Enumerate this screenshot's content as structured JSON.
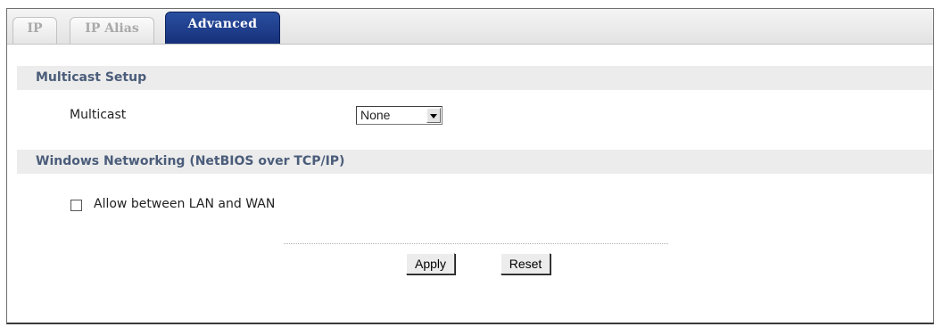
{
  "tabs": [
    {
      "label": "IP",
      "active": false
    },
    {
      "label": "IP Alias",
      "active": false
    },
    {
      "label": "Advanced",
      "active": true
    }
  ],
  "multicast_section": {
    "title": "Multicast Setup",
    "field_label": "Multicast",
    "selected": "None"
  },
  "netbios_section": {
    "title": "Windows Networking (NetBIOS over TCP/IP)",
    "checkbox_label": "Allow between LAN and WAN",
    "checked": false
  },
  "buttons": {
    "apply": "Apply",
    "reset": "Reset"
  }
}
